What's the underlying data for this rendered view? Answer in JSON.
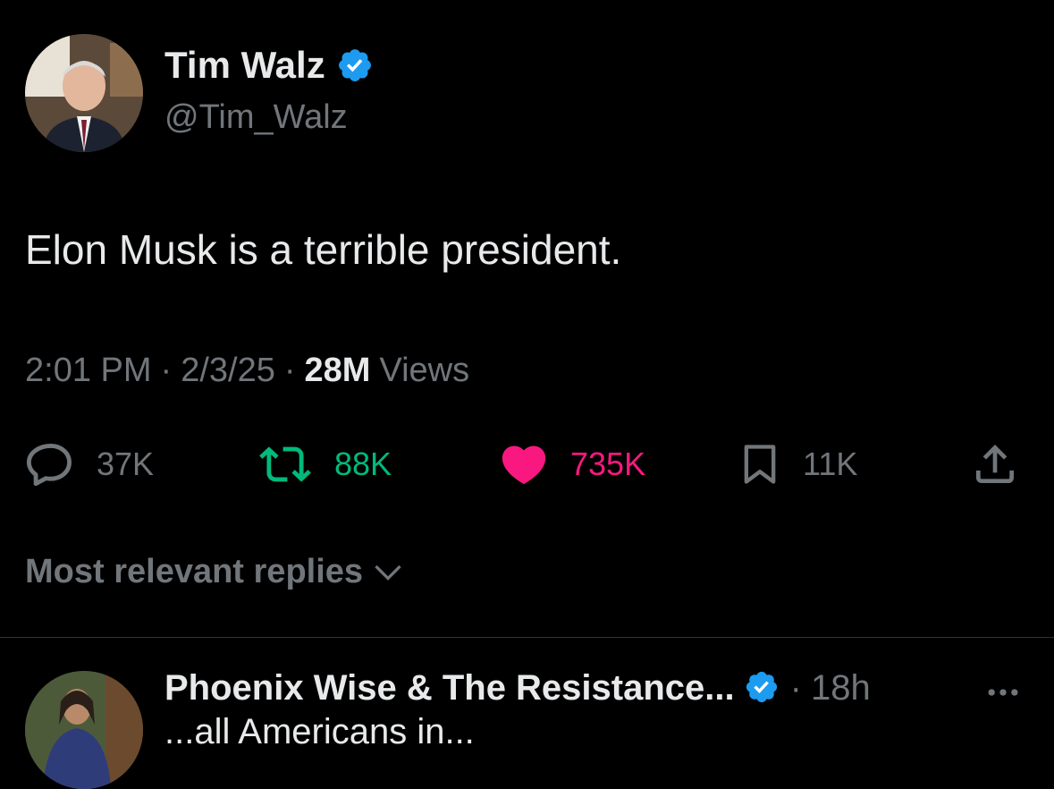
{
  "post": {
    "author_name": "Tim Walz",
    "author_handle": "@Tim_Walz",
    "text": "Elon Musk is a terrible president.",
    "time": "2:01 PM",
    "date": "2/3/25",
    "separator": "·",
    "views_count": "28M",
    "views_label": "Views",
    "icons": {
      "verified": "verified-badge-icon",
      "avatar": "profile-photo"
    }
  },
  "actions": {
    "reply_count": "37K",
    "retweet_count": "88K",
    "like_count": "735K",
    "bookmark_count": "11K",
    "colors": {
      "default": "#71767b",
      "retweet": "#00ba7c",
      "like": "#f91880",
      "verified": "#1d9bf0"
    }
  },
  "replies_sort": {
    "label": "Most relevant replies"
  },
  "reply": {
    "author_name": "Phoenix Wise & The Resistance...",
    "time": "18h",
    "separator": "·",
    "text": "...all Americans in..."
  }
}
